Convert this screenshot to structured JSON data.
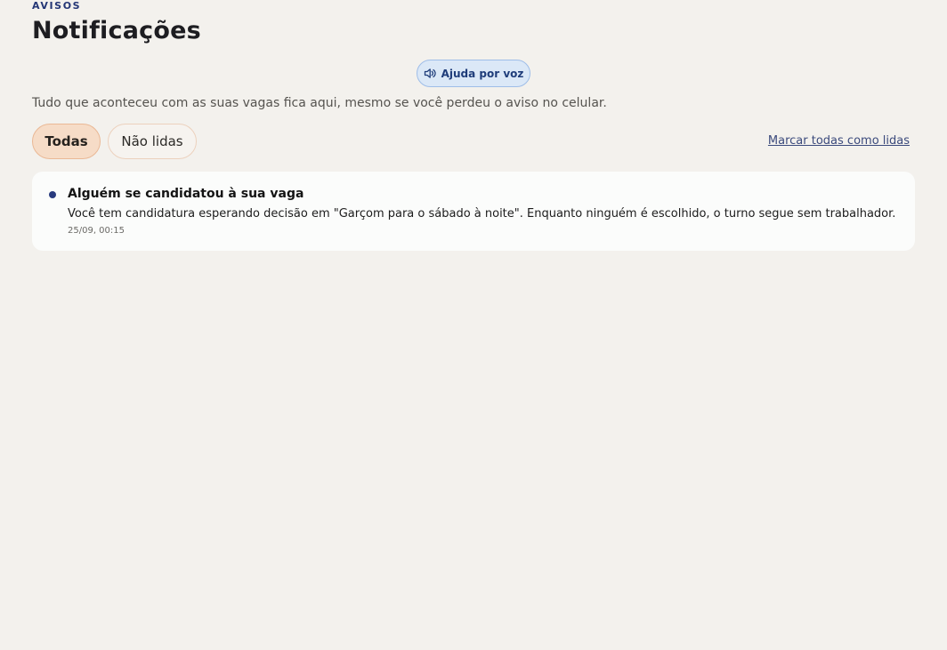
{
  "header": {
    "eyebrow": "AVISOS",
    "title": "Notificações",
    "voice_help": {
      "label": "Ajuda por voz",
      "icon": "speaker-icon"
    },
    "subtitle": "Tudo que aconteceu com as suas vagas fica aqui, mesmo se você perdeu o aviso no celular."
  },
  "filters": {
    "all_label": "Todas",
    "unread_label": "Não lidas",
    "selected": "Todas",
    "mark_all_read": "Marcar todas como lidas"
  },
  "notifications": [
    {
      "title": "Alguém se candidatou à sua vaga",
      "body": "Você tem candidatura esperando decisão em \"Garçom para o sábado à noite\". Enquanto ninguém é escolhido, o turno segue sem trabalhador.",
      "time": "25/09, 00:15",
      "unread": true
    }
  ],
  "colors": {
    "background": "#f3f1ed",
    "accent_navy": "#283a7e",
    "voice_button_bg": "#dbe8f7",
    "active_filter_bg": "#f6dcc7",
    "card_bg": "#fbfcfb"
  }
}
